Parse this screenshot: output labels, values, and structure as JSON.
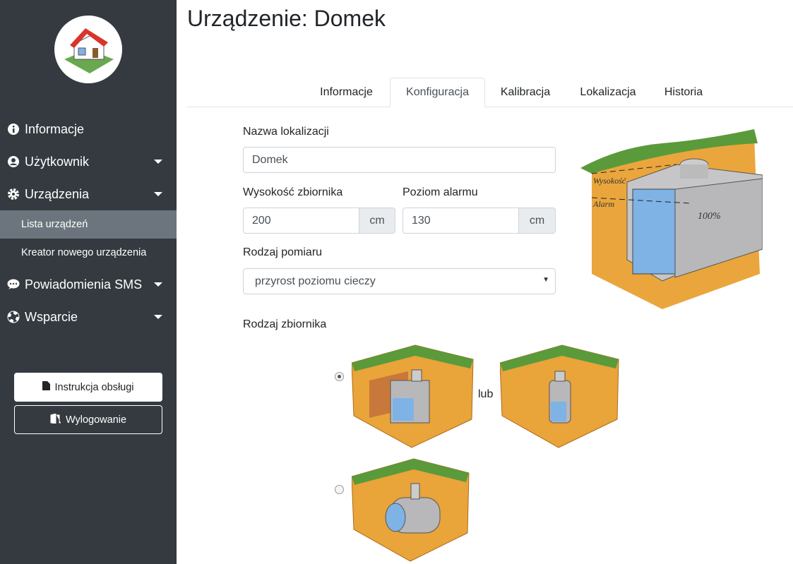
{
  "sidebar": {
    "items": [
      {
        "label": "Informacje",
        "icon": "info-circle-icon"
      },
      {
        "label": "Użytkownik",
        "icon": "user-circle-icon"
      },
      {
        "label": "Urządzenia",
        "icon": "gear-icon"
      },
      {
        "label": "Powiadomienia SMS",
        "icon": "comment-icon"
      },
      {
        "label": "Wsparcie",
        "icon": "life-ring-icon"
      }
    ],
    "subitems": [
      {
        "label": "Lista urządzeń",
        "active": true
      },
      {
        "label": "Kreator nowego urządzenia",
        "active": false
      }
    ],
    "manual_button": "Instrukcja obsługi",
    "logout_button": "Wylogowanie"
  },
  "page": {
    "title": "Urządzenie: Domek"
  },
  "tabs": [
    {
      "label": "Informacje"
    },
    {
      "label": "Konfiguracja",
      "active": true
    },
    {
      "label": "Kalibracja"
    },
    {
      "label": "Lokalizacja"
    },
    {
      "label": "Historia"
    }
  ],
  "form": {
    "location_label": "Nazwa lokalizacji",
    "location_value": "Domek",
    "tank_height_label": "Wysokość zbiornika",
    "tank_height_value": "200",
    "tank_height_unit": "cm",
    "alarm_label": "Poziom alarmu",
    "alarm_value": "130",
    "alarm_unit": "cm",
    "measure_label": "Rodzaj pomiaru",
    "measure_value": "przyrost poziomu cieczy",
    "tank_type_label": "Rodzaj zbiornika",
    "or_text": "lub",
    "tank_type_selected": "prostopadłościenny"
  },
  "illustration": {
    "height_label": "Wysokość",
    "alarm_label": "Alarm",
    "full_label": "100%"
  },
  "colors": {
    "sidebar": "#343a40",
    "active": "#6c757d",
    "soil": "#e9a43a",
    "grass": "#5a9a3a",
    "water": "#7fb2e5"
  }
}
